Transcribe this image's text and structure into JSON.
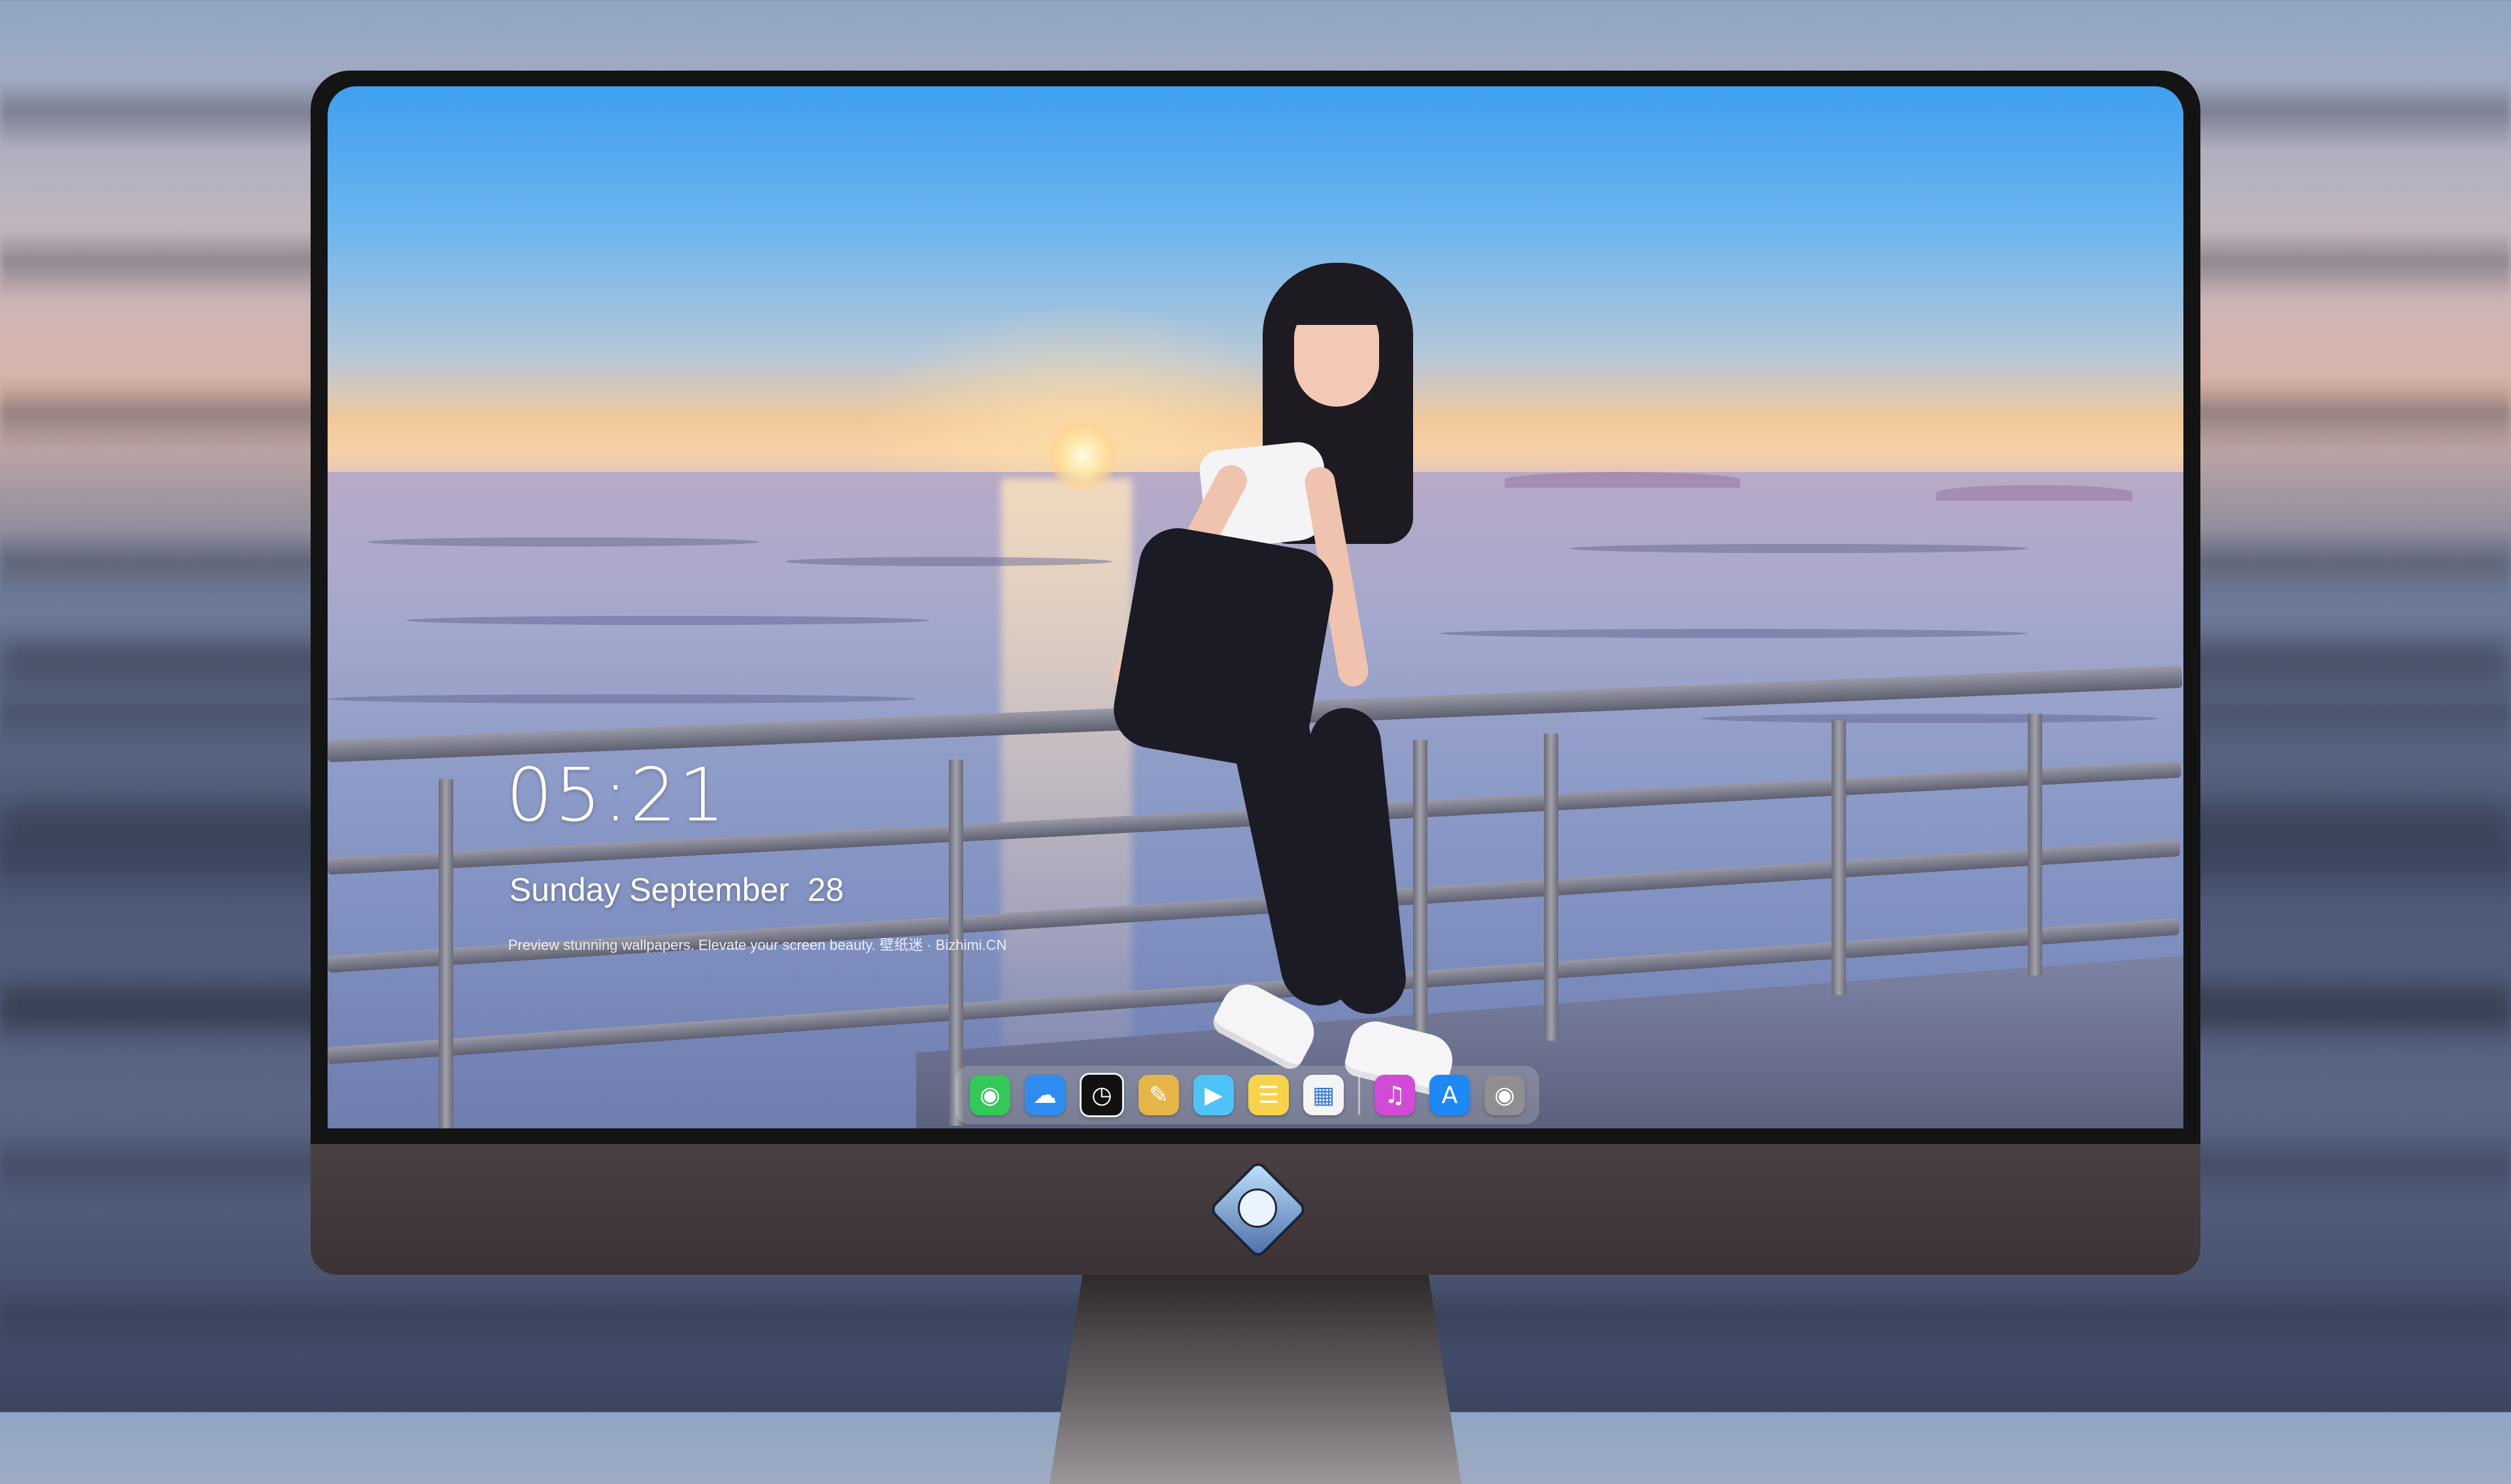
{
  "lock_screen": {
    "time": "05:21",
    "date": "Sunday September  28",
    "tagline": "Preview stunning wallpapers. Elevate your screen beauty. 壁纸迷 · Bizhimi.CN"
  },
  "dock": {
    "apps": [
      {
        "name": "Messages",
        "icon": "messages-icon",
        "color": "#34c759"
      },
      {
        "name": "Weather",
        "icon": "weather-icon",
        "color": "#2f8cf0"
      },
      {
        "name": "Clock",
        "icon": "clock-icon",
        "color": "#111111"
      },
      {
        "name": "Preview",
        "icon": "preview-icon",
        "color": "#e6b54a"
      },
      {
        "name": "Clips",
        "icon": "clips-icon",
        "color": "#4fc3f7"
      },
      {
        "name": "Notes",
        "icon": "notes-icon",
        "color": "#f6d34a"
      },
      {
        "name": "Photo Booth",
        "icon": "photo-app-icon",
        "color": "#f4f4f4"
      },
      {
        "name": "iTunes",
        "icon": "music-icon",
        "color": "#d24bd6"
      },
      {
        "name": "App Store",
        "icon": "app-store-icon",
        "color": "#1e88f5"
      },
      {
        "name": "Camera",
        "icon": "camera-icon",
        "color": "#8e8e93"
      }
    ]
  },
  "monitor": {
    "logo": "mascot-logo-icon"
  }
}
